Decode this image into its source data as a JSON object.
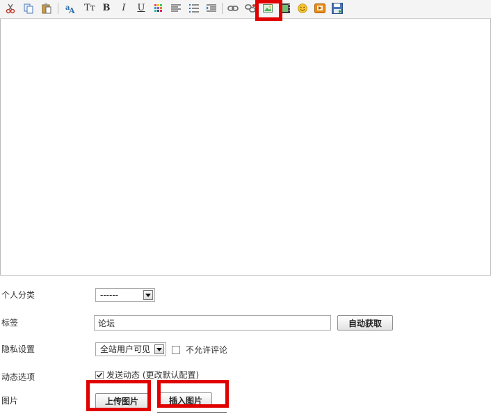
{
  "toolbar": {
    "buttons": [
      {
        "name": "cut-icon"
      },
      {
        "name": "copy-icon"
      },
      {
        "name": "paste-icon"
      },
      {
        "name": "font-icon"
      },
      {
        "name": "font-size-icon",
        "glyph": "Tт"
      },
      {
        "name": "bold-icon",
        "glyph": "B"
      },
      {
        "name": "italic-icon",
        "glyph": "I"
      },
      {
        "name": "underline-icon",
        "glyph": "U"
      },
      {
        "name": "color-icon"
      },
      {
        "name": "align-icon"
      },
      {
        "name": "list-icon"
      },
      {
        "name": "indent-icon"
      },
      {
        "name": "link-icon"
      },
      {
        "name": "unlink-icon"
      },
      {
        "name": "insert-image-icon"
      },
      {
        "name": "insert-video-icon"
      },
      {
        "name": "smiley-icon"
      },
      {
        "name": "insert-flash-icon"
      },
      {
        "name": "save-icon"
      }
    ]
  },
  "form": {
    "category_label": "个人分类",
    "category_value": "------",
    "tags_label": "标签",
    "tags_value": "论坛",
    "auto_fetch_label": "自动获取",
    "privacy_label": "隐私设置",
    "privacy_value": "全站用户可见",
    "no_comment_label": "不允许评论",
    "dynamic_label": "动态选项",
    "send_dynamic_label": "发送动态 (更改默认配置)",
    "image_label": "图片",
    "upload_image_label": "上传图片",
    "insert_image_label": "插入图片"
  },
  "colors": {
    "highlight": "#e10000"
  }
}
